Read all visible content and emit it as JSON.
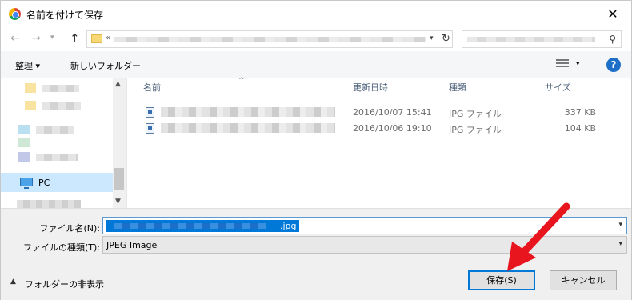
{
  "window": {
    "title": "名前を付けて保存",
    "close_label": "✕"
  },
  "nav": {
    "back": "←",
    "forward": "→",
    "up": "↑",
    "address_prefix": "«",
    "refresh": "↻"
  },
  "toolbar": {
    "organize_label": "整理 ▾",
    "new_folder_label": "新しいフォルダー",
    "help_label": "?"
  },
  "sidebar": {
    "pc_label": "PC"
  },
  "file_list": {
    "columns": {
      "name": "名前",
      "date": "更新日時",
      "type": "種類",
      "size": "サイズ"
    },
    "rows": [
      {
        "date": "2016/10/07 15:41",
        "type": "JPG ファイル",
        "size": "337 KB"
      },
      {
        "date": "2016/10/06 19:10",
        "type": "JPG ファイル",
        "size": "104 KB"
      }
    ]
  },
  "form": {
    "filename_label": "ファイル名(N):",
    "filename_ext": ".jpg",
    "filetype_label": "ファイルの種類(T):",
    "filetype_value": "JPEG Image"
  },
  "footer": {
    "hide_folders_label": "フォルダーの非表示",
    "save_label": "保存(S)",
    "cancel_label": "キャンセル"
  },
  "colors": {
    "accent": "#0078d7",
    "annotation": "#e8141e",
    "selection": "#cce8ff"
  }
}
